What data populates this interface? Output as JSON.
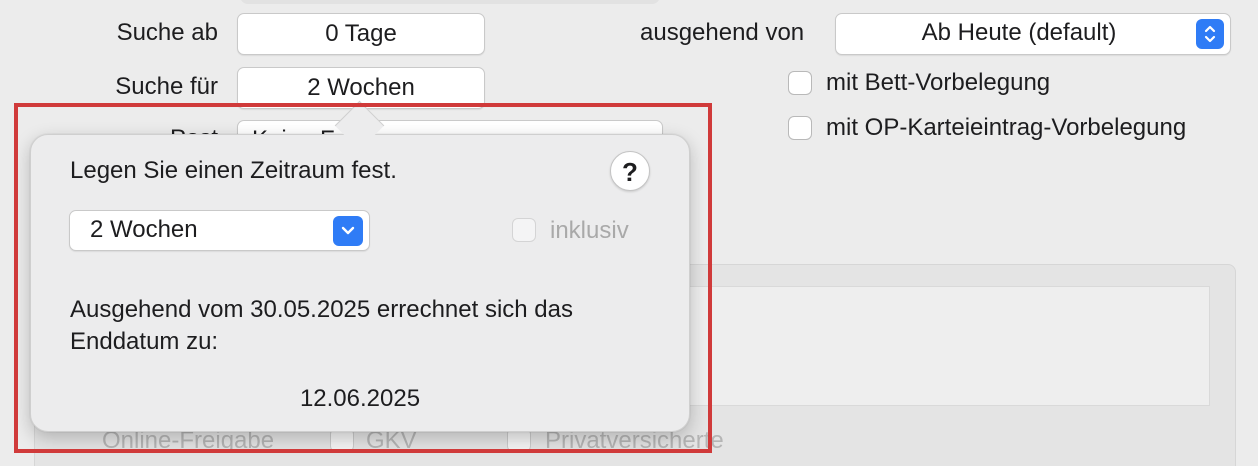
{
  "form": {
    "search_from_label": "Suche ab",
    "search_from_value": "0 Tage",
    "search_for_label": "Suche für",
    "search_for_value": "2 Wochen",
    "partial_label": "Post",
    "partial_select_value": "Keine F",
    "starting_from_label": "ausgehend von",
    "starting_from_value": "Ab Heute (default)",
    "bed_reservation_label": "mit Bett-Vorbelegung",
    "op_entry_label": "mit OP-Karteieintrag-Vorbelegung"
  },
  "background_group": {
    "online_release": "Online-Freigabe",
    "gkv": "GKV",
    "private": "Privatversicherte"
  },
  "popover": {
    "title": "Legen Sie einen Zeitraum fest.",
    "help": "?",
    "period_value": "2 Wochen",
    "inclusive_label": "inklusiv",
    "description": "Ausgehend vom 30.05.2025 errechnet sich das Enddatum zu:",
    "end_date": "12.06.2025"
  },
  "colors": {
    "accent": "#2f7cf6",
    "highlight": "#d03a3a",
    "background": "#ececec"
  }
}
